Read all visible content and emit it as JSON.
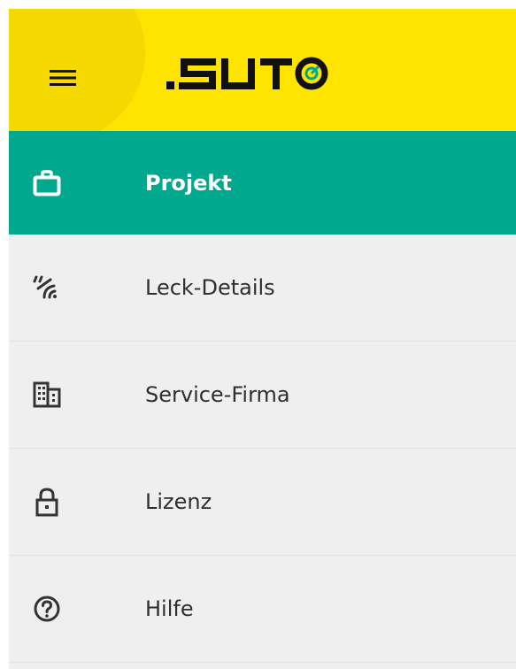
{
  "header": {
    "menu_icon": "hamburger-menu-icon",
    "logo_text": ".SUTO",
    "colors": {
      "header_bg": "#ffe400",
      "menu_circle": "#f4d800",
      "logo_text": "#111111",
      "logo_accent": "#00a98d"
    }
  },
  "nav": {
    "active_color": "#00a98d",
    "items": [
      {
        "label": "Projekt",
        "icon": "briefcase-icon",
        "active": true
      },
      {
        "label": "Leck-Details",
        "icon": "leak-signal-icon",
        "active": false
      },
      {
        "label": "Service-Firma",
        "icon": "building-icon",
        "active": false
      },
      {
        "label": "Lizenz",
        "icon": "lock-icon",
        "active": false
      },
      {
        "label": "Hilfe",
        "icon": "help-circle-icon",
        "active": false
      }
    ]
  }
}
